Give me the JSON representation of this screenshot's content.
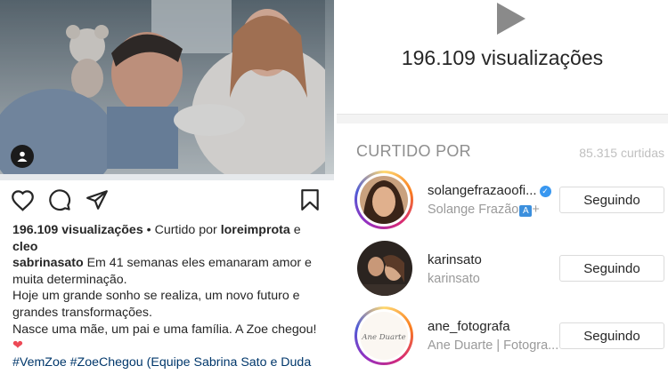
{
  "post": {
    "views_line": "196.109 visualizações",
    "liked_by_prefix": " • Curtido por ",
    "liked_by_user": "loreimprota",
    "liked_by_and": " e",
    "liked_by_other": "cleo",
    "author": "sabrinasato",
    "caption_lines": [
      " Em 41 semanas eles emanaram amor e muita determinação.",
      "Hoje um grande sonho se realiza, um novo futuro e grandes transformações.",
      "Nasce uma mãe, um pai e uma família. A Zoe chegou! ",
      "#VemZoe #ZoeChegou (Equipe Sabrina Sato e Duda"
    ],
    "heart_emoji": "❤",
    "icons": [
      "like-heart-icon",
      "comment-icon",
      "share-icon",
      "bookmark-icon",
      "tagged-user-icon"
    ]
  },
  "viewer": {
    "views_title": "196.109 visualizações",
    "liked_header": "CURTIDO POR",
    "liked_count": "85.315 curtidas",
    "users": [
      {
        "username": "solangefrazaoofi...",
        "full_name": "Solange Frazão",
        "suffix": "+",
        "verified": true,
        "has_story_ring": true,
        "button": "Seguindo"
      },
      {
        "username": "karinsato",
        "full_name": "karinsato",
        "verified": false,
        "has_story_ring": false,
        "button": "Seguindo"
      },
      {
        "username": "ane_fotografa",
        "full_name": "Ane Duarte | Fotogra...",
        "verified": false,
        "has_story_ring": true,
        "button": "Seguindo",
        "avatar_text": "Ane Duarte"
      }
    ]
  },
  "colors": {
    "text": "#262626",
    "muted": "#8e8e8e",
    "hashtag": "#00376b",
    "verified": "#3897f0",
    "heart": "#ed4956"
  }
}
